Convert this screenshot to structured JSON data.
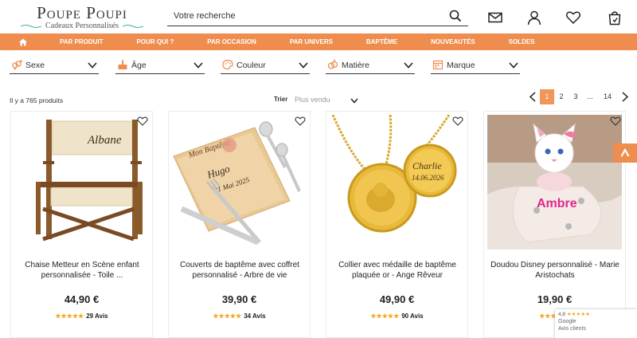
{
  "brand": {
    "name": "Poupe Poupi",
    "tagline": "Cadeaux Personnalisés"
  },
  "search": {
    "placeholder": "Votre recherche"
  },
  "header_icons": [
    "envelope-icon",
    "user-icon",
    "heart-icon",
    "cart-icon"
  ],
  "nav": {
    "home_icon": "home-icon",
    "items": [
      "PAR PRODUIT",
      "POUR QUI ?",
      "PAR OCCASION",
      "PAR UNIVERS",
      "BAPTÊME",
      "NOUVEAUTÉS",
      "SOLDES"
    ]
  },
  "filters": [
    {
      "label": "Sexe",
      "icon": "gender-icon"
    },
    {
      "label": "Âge",
      "icon": "cake-icon"
    },
    {
      "label": "Couleur",
      "icon": "palette-icon"
    },
    {
      "label": "Matière",
      "icon": "rings-icon"
    },
    {
      "label": "Marque",
      "icon": "calendar-icon"
    }
  ],
  "listing": {
    "count_text": "Il y a 765 produits",
    "sort_label": "Trier",
    "sort_value": "Plus vendu"
  },
  "pagination": {
    "pages": [
      "1",
      "2",
      "3",
      "...",
      "14"
    ],
    "active": "1"
  },
  "products": [
    {
      "name": "Chaise Metteur en Scène enfant personnalisée - Toile ...",
      "price": "44,90 €",
      "reviews": "29 Avis",
      "image_text": "Albane"
    },
    {
      "name": "Couverts de baptême avec coffret personnalisé - Arbre de vie",
      "price": "39,90 €",
      "reviews": "34 Avis",
      "image_text": [
        "Mon Baptême",
        "Hugo",
        "31 Mai 2025"
      ]
    },
    {
      "name": "Collier avec médaille de baptême plaquée or - Ange Rêveur",
      "price": "49,90 €",
      "reviews": "90 Avis",
      "image_text": [
        "Charlie",
        "14.06.2026"
      ]
    },
    {
      "name": "Doudou Disney personnalisé - Marie Aristochats",
      "price": "19,90 €",
      "reviews": "",
      "image_text": "Ambre"
    }
  ],
  "rating_stars": "★★★★★",
  "google_badge": {
    "score": "4,8",
    "stars": "★★★★★",
    "brand": "Google",
    "label": "Avis clients"
  },
  "colors": {
    "accent": "#ee8d4e",
    "star": "#f5a623"
  }
}
